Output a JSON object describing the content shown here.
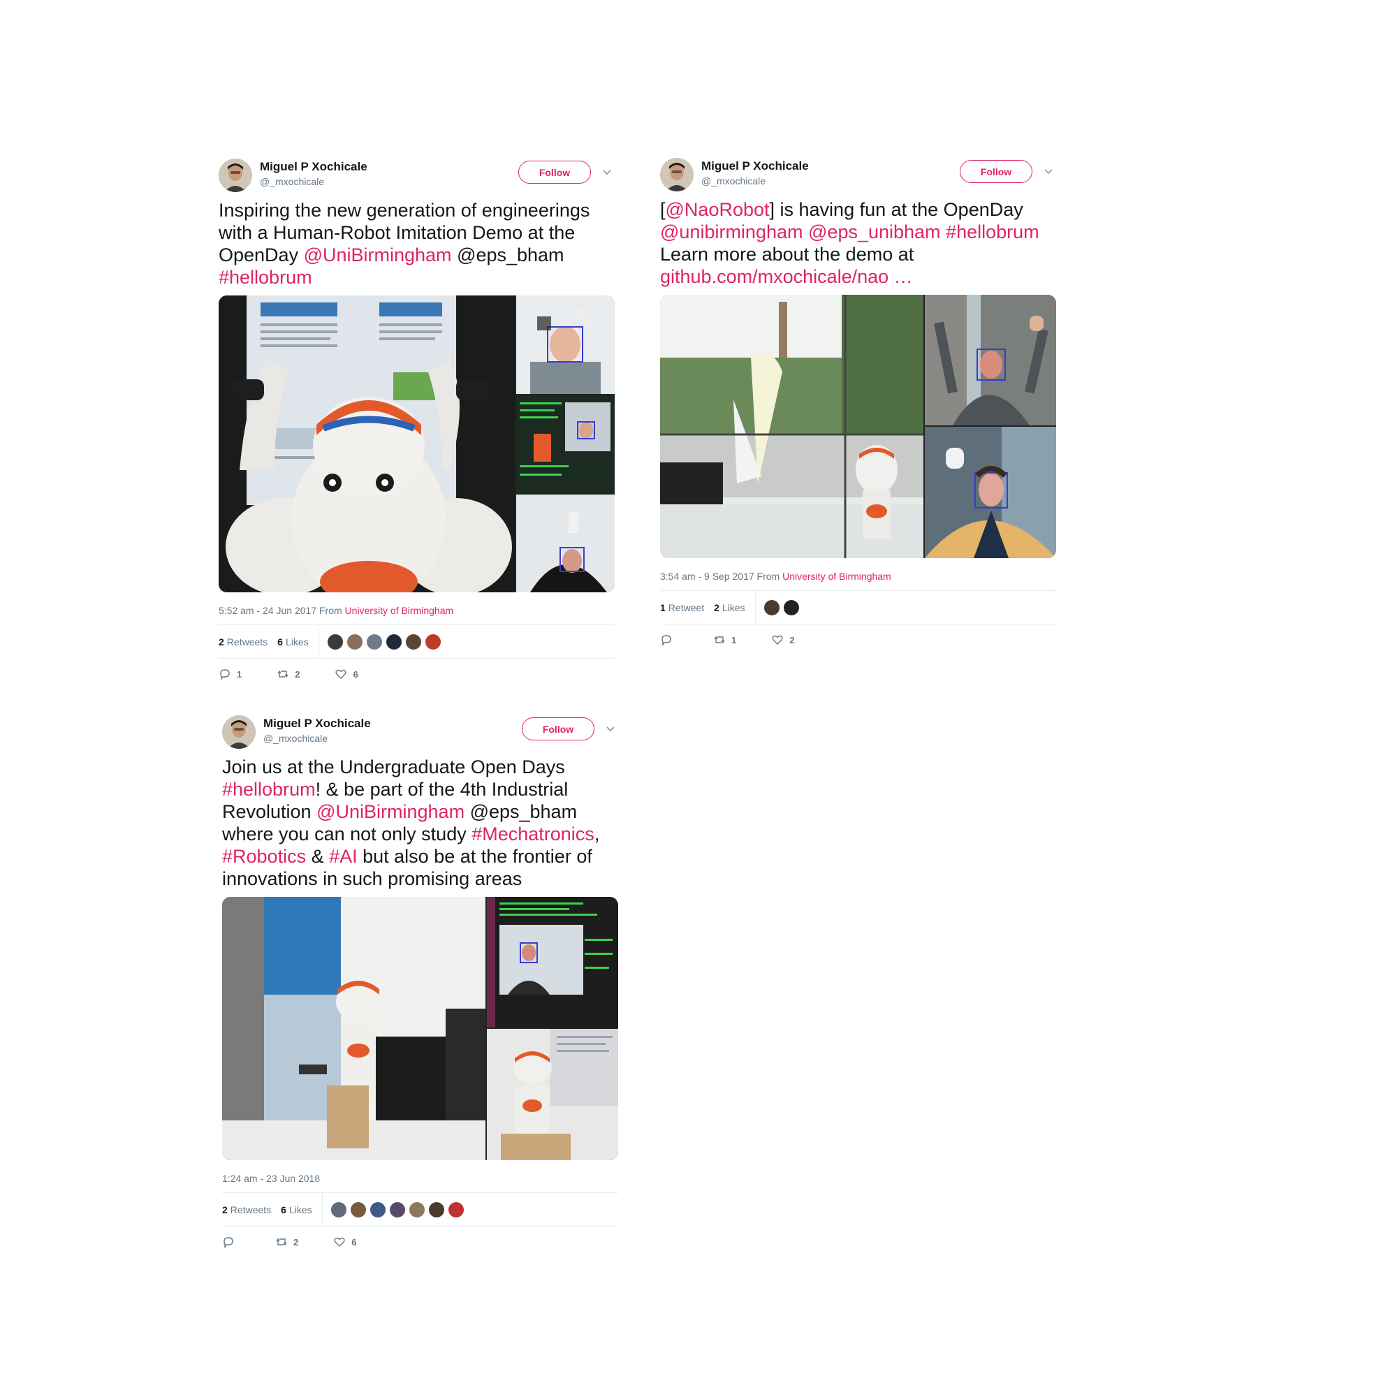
{
  "tweets": [
    {
      "author": "Miguel P Xochicale",
      "handle": "@_mxochicale",
      "follow_label": "Follow",
      "text_segments": [
        {
          "t": "Inspiring the new generation of engineerings with a Human-Robot Imitation Demo at the OpenDay ",
          "hl": false
        },
        {
          "t": "@UniBirmingham",
          "hl": true
        },
        {
          "t": " @eps_bham ",
          "hl": false
        },
        {
          "t": "#hellobrum",
          "hl": true
        }
      ],
      "timestamp": "5:52 am - 24 Jun 2017",
      "from_label": "From",
      "source": "University of Birmingham",
      "retweets": "2",
      "retweets_label": "Retweets",
      "likes": "6",
      "likes_label": "Likes",
      "likers": [
        "#3a3a3a",
        "#8b6d5c",
        "#6f7b8c",
        "#1e2a3a",
        "#5a4636",
        "#c0392b"
      ],
      "replies_count": "1",
      "retweet_count": "2",
      "like_count": "6"
    },
    {
      "author": "Miguel P Xochicale",
      "handle": "@_mxochicale",
      "follow_label": "Follow",
      "text_segments": [
        {
          "t": "[",
          "hl": false
        },
        {
          "t": "@NaoRobot",
          "hl": true
        },
        {
          "t": "] is having fun at the OpenDay ",
          "hl": false
        },
        {
          "t": "@unibirmingham",
          "hl": true
        },
        {
          "t": " ",
          "hl": false
        },
        {
          "t": "@eps_unibham",
          "hl": true
        },
        {
          "t": " ",
          "hl": false
        },
        {
          "t": "#hellobrum",
          "hl": true
        },
        {
          "t": " Learn more about the demo at ",
          "hl": false
        },
        {
          "t": "github.com/mxochicale/nao …",
          "hl": true
        }
      ],
      "timestamp": "3:54 am - 9 Sep 2017",
      "from_label": "From",
      "source": "University of Birmingham",
      "retweets": "1",
      "retweets_label": "Retweet",
      "likes": "2",
      "likes_label": "Likes",
      "likers": [
        "#4a3b2e",
        "#222222"
      ],
      "replies_count": "",
      "retweet_count": "1",
      "like_count": "2"
    },
    {
      "author": "Miguel P Xochicale",
      "handle": "@_mxochicale",
      "follow_label": "Follow",
      "text_segments": [
        {
          "t": "Join us at the Undergraduate Open Days ",
          "hl": false
        },
        {
          "t": "#hellobrum",
          "hl": true
        },
        {
          "t": "! & be part of the 4th Industrial Revolution ",
          "hl": false
        },
        {
          "t": "@UniBirmingham",
          "hl": true
        },
        {
          "t": " @eps_bham where you can not only study ",
          "hl": false
        },
        {
          "t": "#Mechatronics",
          "hl": true
        },
        {
          "t": ", ",
          "hl": false
        },
        {
          "t": "#Robotics",
          "hl": true
        },
        {
          "t": " & ",
          "hl": false
        },
        {
          "t": "#AI",
          "hl": true
        },
        {
          "t": " but also be at the frontier of innovations in such promising areas",
          "hl": false
        }
      ],
      "timestamp": "1:24 am - 23 Jun 2018",
      "from_label": "",
      "source": "",
      "retweets": "2",
      "retweets_label": "Retweets",
      "likes": "6",
      "likes_label": "Likes",
      "likers": [
        "#5e6b78",
        "#7a5a3c",
        "#3c5a8a",
        "#5a4a6a",
        "#8a7a5a",
        "#4a3a2a",
        "#c03030"
      ],
      "replies_count": "",
      "retweet_count": "2",
      "like_count": "6"
    }
  ],
  "colors": {
    "accent": "#e0245e",
    "text": "#14171a",
    "muted": "#657786",
    "divider": "#e6ecf0"
  }
}
